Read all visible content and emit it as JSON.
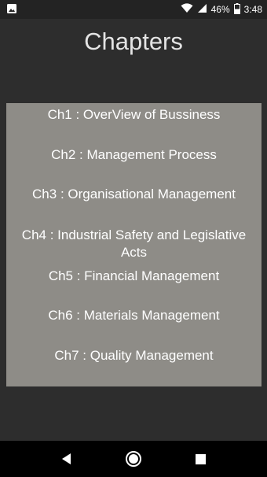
{
  "status_bar": {
    "battery_percent": "46%",
    "time": "3:48",
    "icons": [
      "image-notification-icon",
      "wifi-icon",
      "cell-signal-icon",
      "battery-icon"
    ]
  },
  "screen": {
    "title": "Chapters"
  },
  "chapters": [
    {
      "label": "Ch1 : OverView of Bussiness"
    },
    {
      "label": "Ch2 : Management Process"
    },
    {
      "label": "Ch3 : Organisational Management"
    },
    {
      "label": "Ch4 : Industrial Safety and Legislative Acts"
    },
    {
      "label": "Ch5 : Financial Management"
    },
    {
      "label": "Ch6 : Materials Management"
    },
    {
      "label": "Ch7 : Quality Management"
    }
  ],
  "nav_bar": {
    "buttons": [
      "back-icon",
      "home-icon",
      "recents-icon"
    ]
  },
  "colors": {
    "background": "#2d2d2d",
    "panel": "#8e8c87",
    "status_bar": "#232323",
    "nav_bar": "#000000",
    "title_text": "#e4e4e4"
  }
}
